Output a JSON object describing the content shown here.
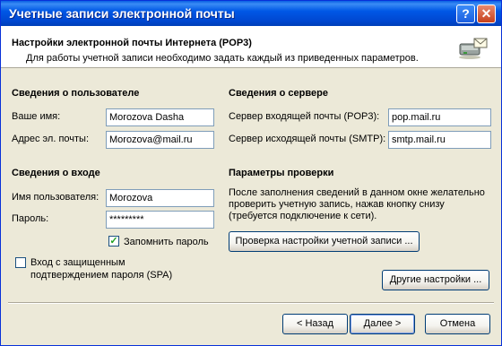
{
  "window": {
    "title": "Учетные записи электронной почты",
    "help_label": "?",
    "close_label": "✕"
  },
  "header": {
    "title": "Настройки электронной почты Интернета (POP3)",
    "subtitle": "Для работы учетной записи необходимо задать каждый из приведенных параметров."
  },
  "user_info": {
    "section": "Сведения о пользователе",
    "name_label": "Ваше имя:",
    "name_value": "Morozova Dasha",
    "email_label": "Адрес эл. почты:",
    "email_value": "Morozova@mail.ru"
  },
  "server_info": {
    "section": "Сведения о сервере",
    "incoming_label": "Сервер входящей почты  (POP3):",
    "incoming_value": "pop.mail.ru",
    "outgoing_label": "Сервер исходящей почты (SMTP):",
    "outgoing_value": "smtp.mail.ru"
  },
  "logon_info": {
    "section": "Сведения о входе",
    "username_label": "Имя пользователя:",
    "username_value": "Morozova",
    "password_label": "Пароль:",
    "password_value": "*********",
    "remember_label": "Запомнить пароль",
    "remember_checked": true,
    "spa_label_line1": "Вход с защищенным",
    "spa_label_line2": "подтверждением пароля (SPA)",
    "spa_checked": false
  },
  "test_settings": {
    "section": "Параметры проверки",
    "desc_line1": "После заполнения сведений в данном окне желательно",
    "desc_line2": "проверить учетную запись, нажав кнопку снизу",
    "desc_line3": "(требуется подключение к сети).",
    "test_button": "Проверка настройки учетной записи ..."
  },
  "buttons": {
    "more_settings": "Другие настройки ...",
    "back": "< Назад",
    "next": "Далее >",
    "cancel": "Отмена"
  },
  "icons": {
    "header": "mail-server-icon",
    "check": "checkmark-icon"
  }
}
